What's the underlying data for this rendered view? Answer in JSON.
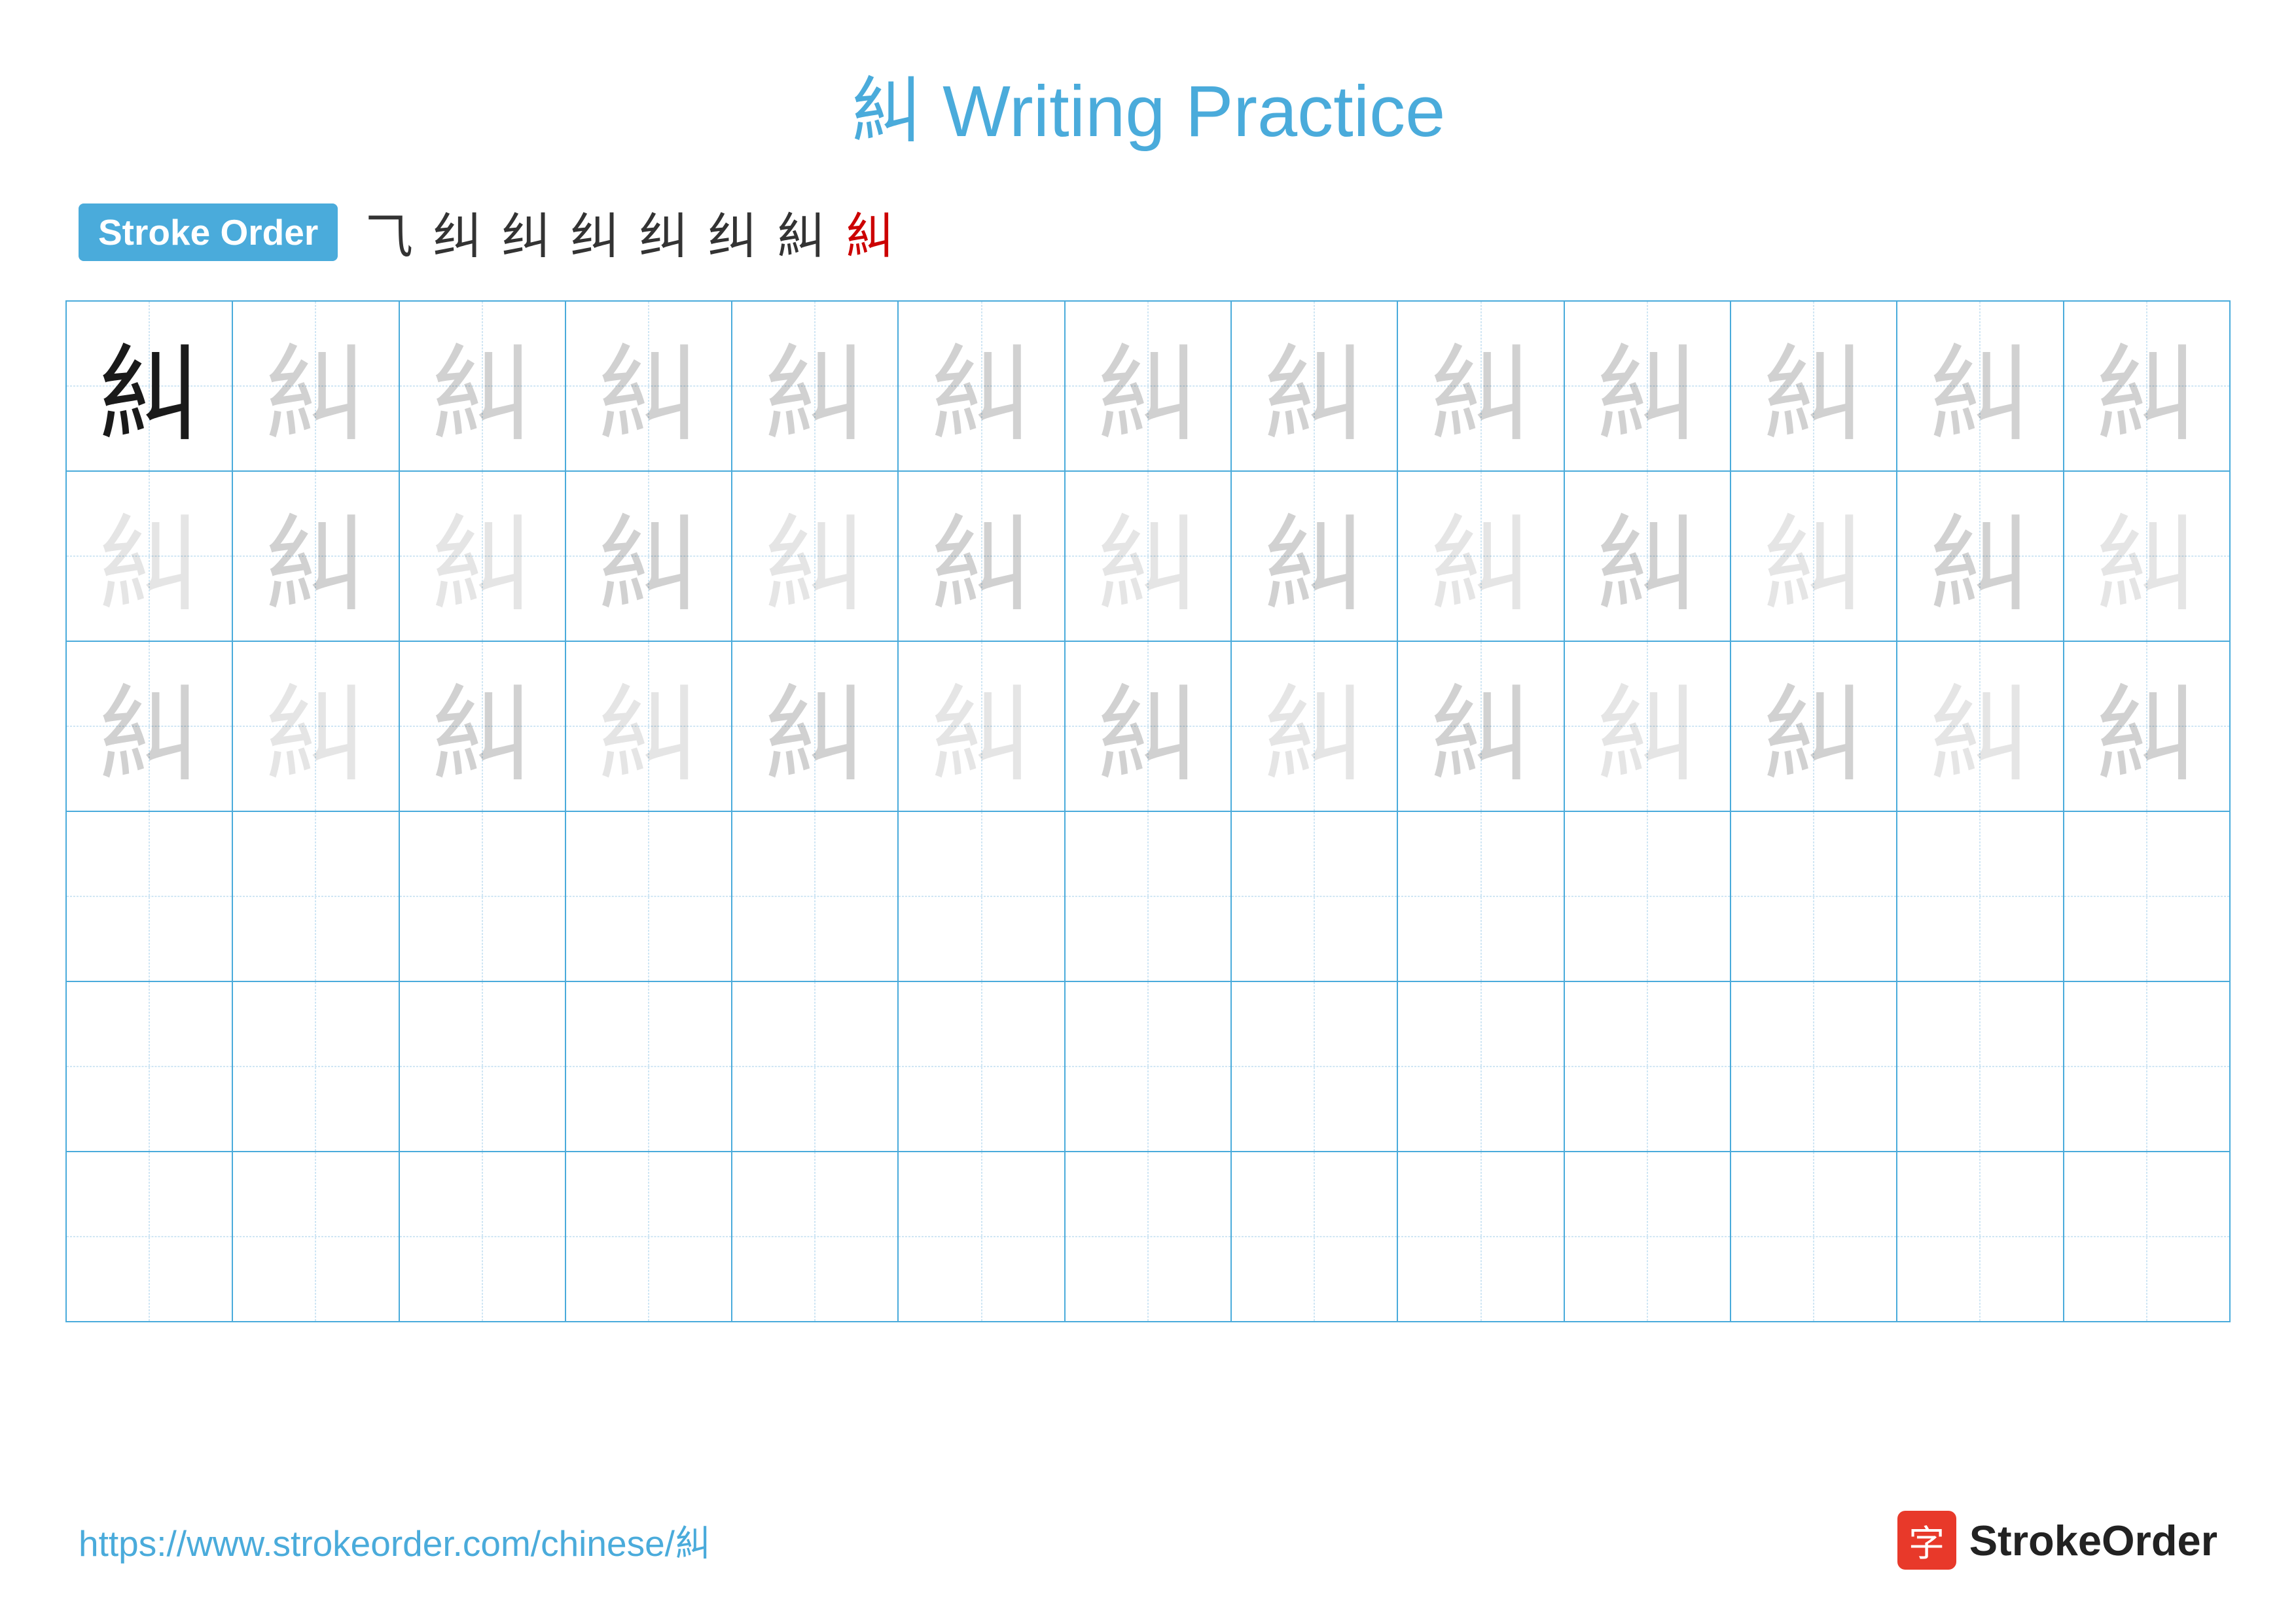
{
  "title": {
    "char": "糾",
    "text": "Writing Practice",
    "full": "糾 Writing Practice"
  },
  "stroke_order": {
    "badge_label": "Stroke Order",
    "strokes": [
      "⺄",
      "糺",
      "糺",
      "糺",
      "糺",
      "糺",
      "糾",
      "糾"
    ]
  },
  "grid": {
    "rows": 6,
    "cols": 13,
    "char": "糾",
    "row_types": [
      "dark_then_light1",
      "light2",
      "light2",
      "empty",
      "empty",
      "empty"
    ]
  },
  "footer": {
    "url": "https://www.strokeorder.com/chinese/糾",
    "logo_char": "字",
    "logo_text": "StrokeOrder"
  }
}
